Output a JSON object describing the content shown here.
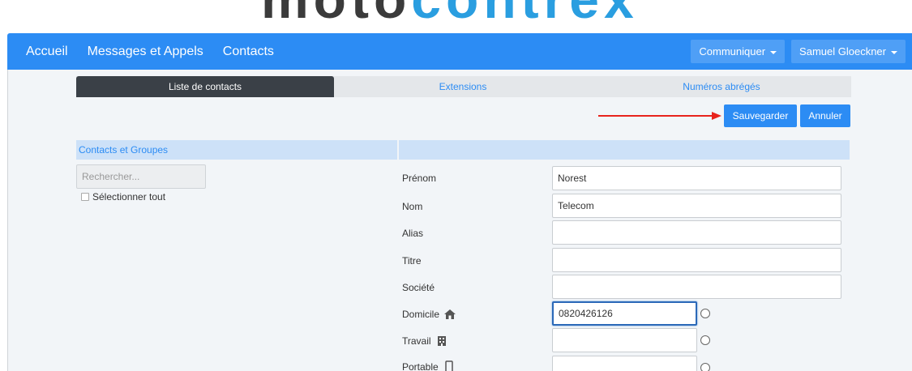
{
  "logo": {
    "part_a": "moto",
    "part_b": "contrex",
    "colors": {
      "dark": "#3b3b3b",
      "blue": "#2a9ee0"
    }
  },
  "nav": {
    "links": [
      "Accueil",
      "Messages et Appels",
      "Contacts"
    ],
    "communicate_label": "Communiquer",
    "user_label": "Samuel Gloeckner",
    "bg_color": "#2c8cf4"
  },
  "tabs": [
    "Liste de contacts",
    "Extensions",
    "Numéros abrégés"
  ],
  "actions": {
    "save_label": "Sauvegarder",
    "cancel_label": "Annuler"
  },
  "left_panel": {
    "header": "Contacts et Groupes",
    "search_placeholder": "Rechercher...",
    "select_all_label": "Sélectionner tout"
  },
  "form": {
    "fields": [
      {
        "label": "Prénom",
        "value": "Norest"
      },
      {
        "label": "Nom",
        "value": "Telecom"
      },
      {
        "label": "Alias",
        "value": ""
      },
      {
        "label": "Titre",
        "value": ""
      },
      {
        "label": "Société",
        "value": ""
      },
      {
        "label": "Domicile",
        "value": "0820426126",
        "icon": "home-icon"
      },
      {
        "label": "Travail",
        "value": "",
        "icon": "building-icon"
      },
      {
        "label": "Portable",
        "value": "",
        "icon": "mobile-phone-icon"
      }
    ]
  }
}
